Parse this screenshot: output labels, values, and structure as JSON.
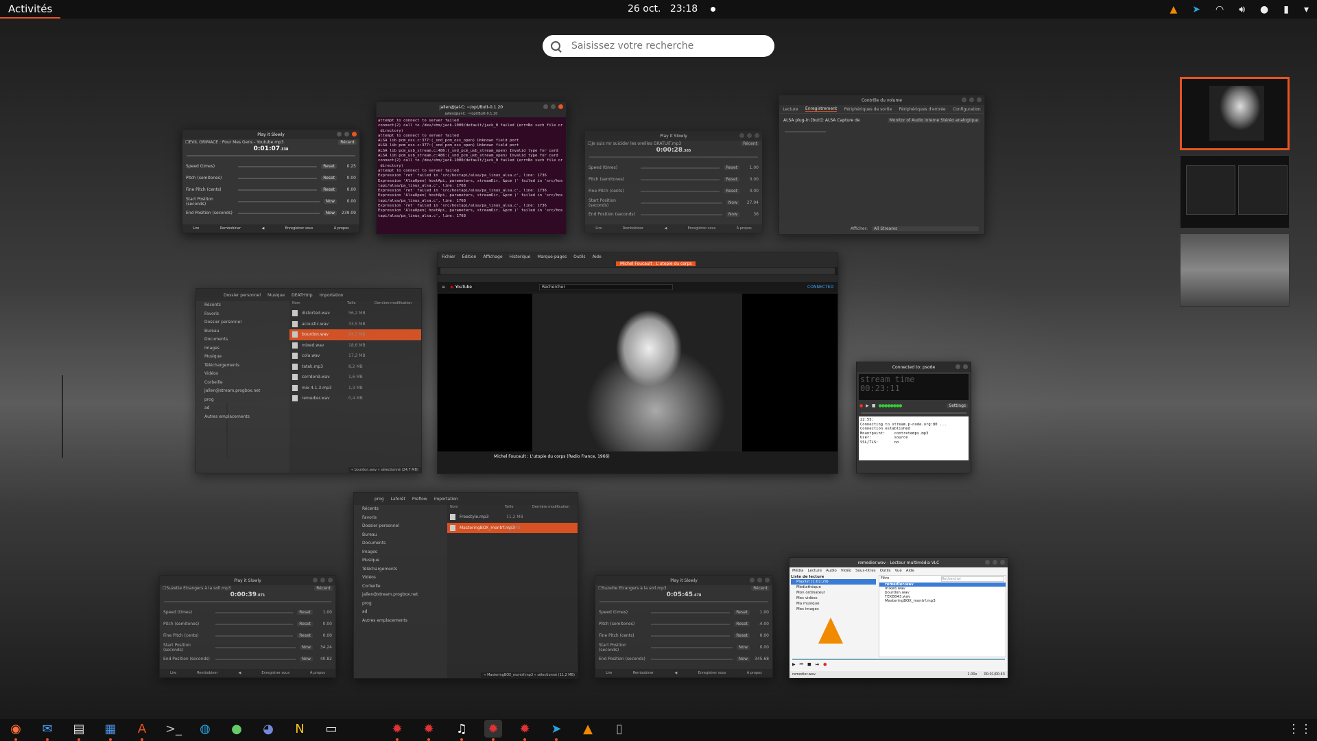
{
  "topbar": {
    "activities": "Activités",
    "date": "26 oct.",
    "time": "23:18"
  },
  "search": {
    "placeholder": "Saisissez votre recherche"
  },
  "windows": {
    "pis1": {
      "title": "Play it Slowly",
      "file": "EVIL GRIMACE : Pour Mes Gens - Youtube.mp3",
      "time": "0:01:07",
      "time_ms": ".338",
      "rows": [
        {
          "label": "Speed (times)",
          "btn": "Reset",
          "val": "0.25"
        },
        {
          "label": "Pitch (semitones)",
          "btn": "Reset",
          "val": "0.00"
        },
        {
          "label": "Fine Pitch (cents)",
          "btn": "Reset",
          "val": "0.00"
        },
        {
          "label": "Start Position (seconds)",
          "btn": "Now",
          "val": "0.00"
        },
        {
          "label": "End Position (seconds)",
          "btn": "Now",
          "val": "239.09"
        }
      ],
      "footer": [
        "Lire",
        "Rembobiner",
        "◀",
        "Enregistrer sous",
        "À propos"
      ]
    },
    "terminal": {
      "title": "jallen@jal-C: ~/opt/Butt-0.1.20",
      "lines": [
        "attempt to connect to server failed",
        "connect(2) call to /dev/shm/jack-1000/default/jack_0 failed (err=No such file or",
        " directory)",
        "attempt to connect to server failed",
        "ALSA lib pcm_oss.c:377:(_snd_pcm_oss_open) Unknown field port",
        "ALSA lib pcm_oss.c:377:(_snd_pcm_oss_open) Unknown field port",
        "ALSA lib pcm_usb_stream.c:486:(_snd_pcm_usb_stream_open) Invalid type for card",
        "ALSA lib pcm_usb_stream.c:486:(_snd_pcm_usb_stream_open) Invalid type for card",
        "connect(2) call to /dev/shm/jack-1000/default/jack_0 failed (err=No such file or",
        " directory)",
        "attempt to connect to server failed",
        "Expression 'ret' failed in 'src/hostapi/alsa/pa_linux_alsa.c', line: 1736",
        "Expression 'AlsaOpen( hostApi, parameters, streamDir, &pcm )' failed in 'src/hos",
        "tapi/alsa/pa_linux_alsa.c', line: 1768",
        "Expression 'ret' failed in 'src/hostapi/alsa/pa_linux_alsa.c', line: 1736",
        "Expression 'AlsaOpen( hostApi, parameters, streamDir, &pcm )' failed in 'src/hos",
        "tapi/alsa/pa_linux_alsa.c', line: 1768",
        "Expression 'ret' failed in 'src/hostapi/alsa/pa_linux_alsa.c', line: 1736",
        "Expression 'AlsaOpen( hostApi, parameters, streamDir, &pcm )' failed in 'src/hos",
        "tapi/alsa/pa_linux_alsa.c', line: 1768"
      ]
    },
    "pis2": {
      "title": "Play it Slowly",
      "file": "Je suis mr suicider les oreilles GRATUIT.mp3",
      "time": "0:00:28",
      "time_ms": ".385",
      "rows": [
        {
          "label": "Speed (times)",
          "btn": "Reset",
          "val": "1.00"
        },
        {
          "label": "Pitch (semitones)",
          "btn": "Reset",
          "val": "0.00"
        },
        {
          "label": "Fine Pitch (cents)",
          "btn": "Reset",
          "val": "0.00"
        },
        {
          "label": "Start Position (seconds)",
          "btn": "Now",
          "val": "27.94"
        },
        {
          "label": "End Position (seconds)",
          "btn": "Now",
          "val": "36"
        }
      ],
      "footer": [
        "Lire",
        "Rembobiner",
        "◀",
        "Enregistrer sous",
        "À propos"
      ]
    },
    "volume": {
      "title": "Contrôle du volume",
      "tabs": [
        "Lecture",
        "Enregistrement",
        "Périphériques de sortie",
        "Périphériques d'entrée",
        "Configuration"
      ],
      "device": "ALSA plug-in [butt]: ALSA Capture de",
      "monitor": "Monitor of Audio interne Stéréo analogique",
      "afficher": "Afficher:",
      "afficher_val": "All Streams"
    },
    "files1": {
      "title": "Dossier personnel",
      "crumbs": [
        "Musique",
        "DEATHtrip",
        "importation"
      ],
      "side": [
        "Récents",
        "Favoris",
        "Dossier personnel",
        "Bureau",
        "Documents",
        "Images",
        "Musique",
        "Téléchargements",
        "Vidéos",
        "Corbeille",
        "jallen@stream.progbox.net",
        "prog",
        "ad",
        "Autres emplacements"
      ],
      "cols": [
        "Nom",
        "Taille",
        "Dernière modification"
      ],
      "files": [
        "distorted.wav",
        "acoustic.wav",
        "bourdon.wav",
        "mixed.wav",
        "cola.wav",
        "tatak.mp3",
        "cerrdon9.wav",
        "mix 4.1.3.mp3",
        "remedier.wav"
      ],
      "sizes": [
        "56,2 MB",
        "33,5 MB",
        "24,7 MB",
        "18,6 MB",
        "17,2 MB",
        "8,2 MB",
        "1,6 MB",
        "1,3 MB",
        "0,4 MB"
      ],
      "status": "« bourdon.wav » sélectionné (24,7 MB)"
    },
    "browser": {
      "menus": [
        "Fichier",
        "Édition",
        "Affichage",
        "Historique",
        "Marque-pages",
        "Outils",
        "Aide"
      ],
      "tab": "Michel Foucault : L'utopie du corps",
      "yt_search": "Rechercher",
      "video_title": "Michel Foucault : L'utopie du corps (Radio France, 1966)",
      "status": "CONNECTED"
    },
    "butt": {
      "title": "Connected to: psode",
      "lcd1": "stream time",
      "lcd2": "00:23:11",
      "settings": "Settings",
      "log": [
        "22:55:",
        "Connecting to stream.p-node.org:80 ...",
        "Connection established",
        "Mountpoint:    contretemps.mp3",
        "User:          source",
        "SSL/TLS:       no"
      ]
    },
    "files2": {
      "crumbs": [
        "prog",
        "Laforêt",
        "Preflow",
        "importation"
      ],
      "side": [
        "Récents",
        "Favoris",
        "Dossier personnel",
        "Bureau",
        "Documents",
        "Images",
        "Musique",
        "Téléchargements",
        "Vidéos",
        "Corbeille",
        "jallen@stream.progbox.net",
        "prog",
        "ad",
        "Autres emplacements"
      ],
      "cols": [
        "Nom",
        "Taille",
        "Dernière modification"
      ],
      "files": [
        "Freestyle.mp3",
        "MasteringBOX_montrf.mp3"
      ],
      "sizes": [
        "11,2 MB",
        "4,2 MB"
      ],
      "status": "« MasteringBOX_montrf.mp3 » sélectionné (11,2 MB)"
    },
    "pis3": {
      "title": "Play it Slowly",
      "file": "Suzette Etrangers à la soll.mp3",
      "time": "0:00:39",
      "time_ms": ".071",
      "rows": [
        {
          "label": "Speed (times)",
          "btn": "Reset",
          "val": "1.00"
        },
        {
          "label": "Pitch (semitones)",
          "btn": "Reset",
          "val": "0.00"
        },
        {
          "label": "Fine Pitch (cents)",
          "btn": "Reset",
          "val": "0.00"
        },
        {
          "label": "Start Position (seconds)",
          "btn": "Now",
          "val": "34.24"
        },
        {
          "label": "End Position (seconds)",
          "btn": "Now",
          "val": "40.82"
        }
      ],
      "footer": [
        "Lire",
        "Rembobiner",
        "◀",
        "Enregistrer sous",
        "À propos"
      ]
    },
    "pis4": {
      "title": "Play it Slowly",
      "file": "Suzette Etrangers à la soll.mp3",
      "time": "0:05:45",
      "time_ms": ".478",
      "rows": [
        {
          "label": "Speed (times)",
          "btn": "Reset",
          "val": "1.00"
        },
        {
          "label": "Pitch (semitones)",
          "btn": "Reset",
          "val": "-4.00"
        },
        {
          "label": "Fine Pitch (cents)",
          "btn": "Reset",
          "val": "0.00"
        },
        {
          "label": "Start Position (seconds)",
          "btn": "Now",
          "val": "0.00"
        },
        {
          "label": "End Position (seconds)",
          "btn": "Now",
          "val": "345.68"
        }
      ],
      "footer": [
        "Lire",
        "Rembobiner",
        "◀",
        "Enregistrer sous",
        "À propos"
      ]
    },
    "vlc": {
      "title": "remedier.wav - Lecteur multimédia VLC",
      "menus": [
        "Média",
        "Lecture",
        "Audio",
        "Vidéo",
        "Sous-titres",
        "Outils",
        "Vue",
        "Aide"
      ],
      "list_title": "Liste de lecture",
      "tree": [
        "Playlist (1:01:29)",
        "Médiathèque",
        "Mon ordinateur",
        "Mes vidéos",
        "Ma musique",
        "Mes images"
      ],
      "filter": "Filtre",
      "search_ph": "Rechercher",
      "items": [
        "remedier.wav",
        "mixed.wav",
        "bourdon.wav",
        "TEK8843.wav",
        "MasteringBOX_montrf.mp3"
      ],
      "status_file": "remedier.wav",
      "speed": "1.00x",
      "time": "00:01/00:43"
    }
  },
  "dock": [
    "firefox",
    "thunderbird",
    "files",
    "libreoffice-writer",
    "software",
    "terminal",
    "app-round",
    "app-green",
    "discord",
    "n-app",
    "text-editor",
    "app-red",
    "app-red",
    "music",
    "app-red",
    "app-red",
    "telegram",
    "vlc",
    "file-app",
    "apps-grid"
  ],
  "colors": {
    "accent": "#e95420",
    "terminal": "#300a24",
    "topbar": "#111111"
  }
}
